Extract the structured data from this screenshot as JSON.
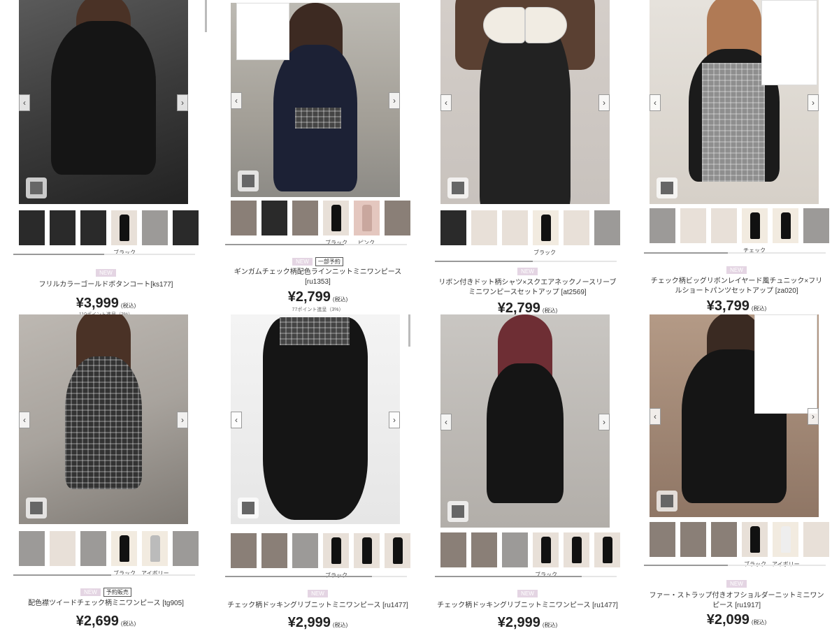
{
  "products": [
    {
      "name": "フリルカラーゴールドボタンコート[ks177]",
      "price": "¥3,999",
      "tax": "(税込)",
      "points": "110ポイント進呈（3%）",
      "badges": [
        "NEW"
      ],
      "thumb_labels": [
        {
          "text": "ブラック",
          "index": 3
        }
      ]
    },
    {
      "name": "ギンガムチェック柄配色ラインニットミニワンピース [ru1353]",
      "price": "¥2,799",
      "tax": "(税込)",
      "points": "77ポイント進呈（3%）",
      "badges": [
        "NEW",
        "一部予約"
      ],
      "thumb_labels": [
        {
          "text": "ブラック",
          "index": 3
        },
        {
          "text": "ピンク",
          "index": 4
        }
      ]
    },
    {
      "name": "リボン付きドット柄シャツ×スクエアネックノースリーブミニワンピースセットアップ [at2569]",
      "price": "¥2,799",
      "tax": "(税込)",
      "points": "",
      "badges": [
        "NEW"
      ],
      "thumb_labels": [
        {
          "text": "ブラック",
          "index": 3
        }
      ]
    },
    {
      "name": "チェック柄ビッグリボンレイヤード風チュニック×フリルショートパンツセットアップ [za020]",
      "price": "¥3,799",
      "tax": "(税込)",
      "points": "",
      "badges": [
        "NEW"
      ],
      "thumb_labels": [
        {
          "text": "チェック",
          "index": 3
        }
      ]
    },
    {
      "name": "配色襟ツイードチェック柄ミニワンピース [tg905]",
      "price": "¥2,699",
      "tax": "(税込)",
      "points": "",
      "badges": [
        "NEW",
        "予約販売"
      ],
      "thumb_labels": [
        {
          "text": "ブラック",
          "index": 3
        },
        {
          "text": "アイボリー",
          "index": 4
        }
      ]
    },
    {
      "name": "チェック柄ドッキングリブニットミニワンピース [ru1477]",
      "price": "¥2,999",
      "tax": "(税込)",
      "points": "",
      "badges": [
        "NEW"
      ],
      "thumb_labels": [
        {
          "text": "ブラック",
          "index": 3
        }
      ]
    },
    {
      "name": "チェック柄ドッキングリブニットミニワンピース [ru1477]",
      "price": "¥2,999",
      "tax": "(税込)",
      "points": "",
      "badges": [
        "NEW"
      ],
      "thumb_labels": [
        {
          "text": "ブラック",
          "index": 3
        }
      ]
    },
    {
      "name": "ファー・ストラップ付きオフショルダーニットミニワンピース [ru1917]",
      "price": "¥2,099",
      "tax": "(税込)",
      "points": "",
      "badges": [
        "NEW"
      ],
      "thumb_labels": [
        {
          "text": "ブラック",
          "index": 3
        },
        {
          "text": "アイボリー",
          "index": 4
        }
      ]
    }
  ],
  "icons": {
    "prev": "chevron-left-icon",
    "next": "chevron-right-icon",
    "grid": "grid-icon"
  },
  "colors": {
    "badge_new": "#e4d5e3",
    "price_text": "#222222"
  }
}
